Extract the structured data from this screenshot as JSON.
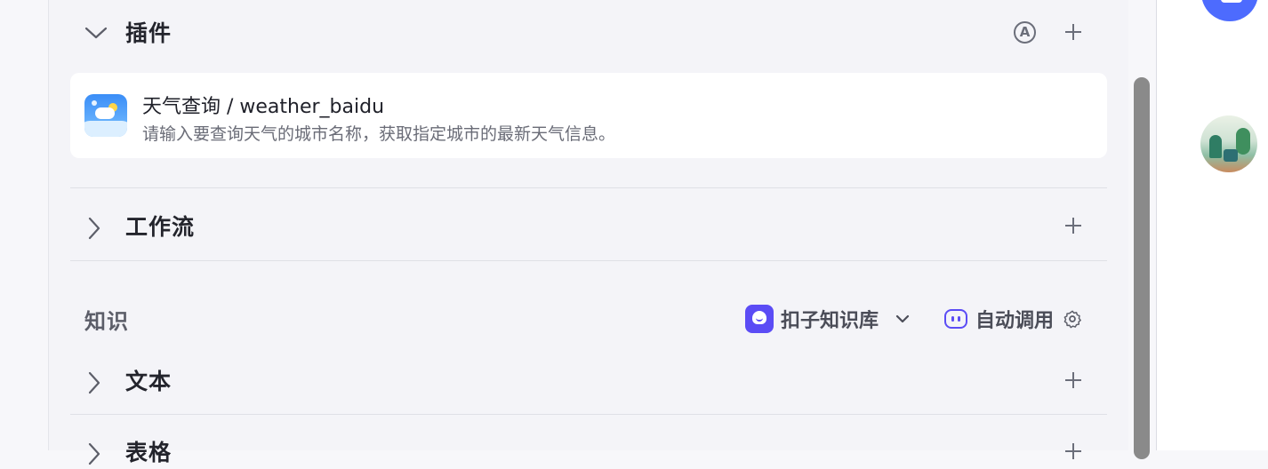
{
  "plugins": {
    "title": "插件",
    "auto_badge": "A",
    "card": {
      "name": "天气查询 / weather_baidu",
      "description": "请输入要查询天气的城市名称，获取指定城市的最新天气信息。"
    }
  },
  "workflow": {
    "title": "工作流"
  },
  "knowledge": {
    "title": "知识",
    "source_label": "扣子知识库",
    "auto_call_label": "自动调用"
  },
  "text_section": {
    "title": "文本"
  },
  "table_section": {
    "title": "表格"
  },
  "colors": {
    "accent": "#5b4cf5",
    "blue_button": "#4d6bfe",
    "scrollbar": "#8a8a8a"
  },
  "icons": [
    "chevron-down-icon",
    "chevron-right-icon",
    "auto-mode-icon",
    "plus-icon",
    "weather-plugin-icon",
    "knowledge-base-icon",
    "auto-call-bot-icon",
    "gear-icon",
    "user-avatar"
  ]
}
